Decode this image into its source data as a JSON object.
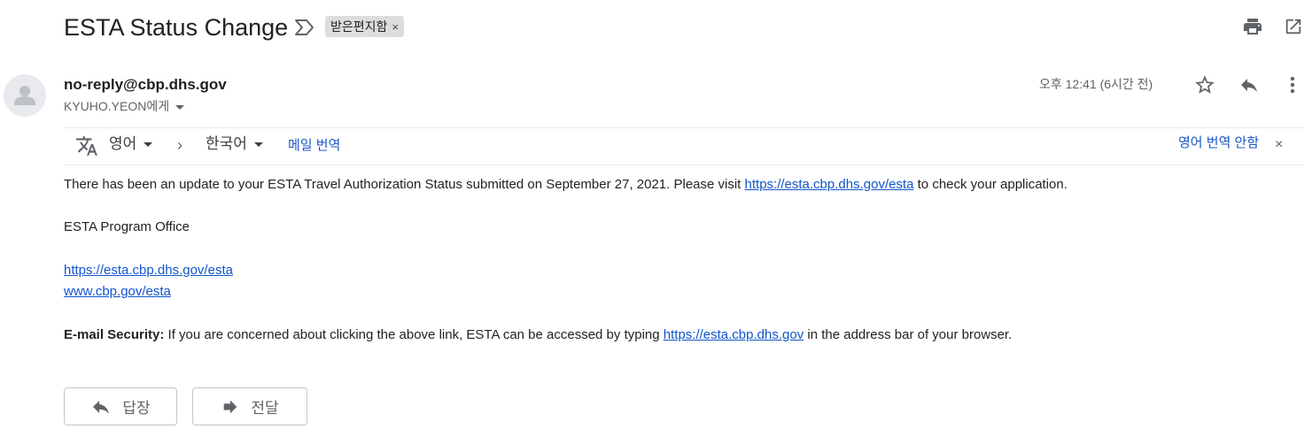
{
  "subject": "ESTA Status Change",
  "label_chip": {
    "text": "받은편지함",
    "remove_glyph": "×"
  },
  "sender": {
    "email": "no-reply@cbp.dhs.gov",
    "recipient": "KYUHO.YEON에게",
    "timestamp": "오후 12:41 (6시간 전)"
  },
  "translation_bar": {
    "from_language": "영어",
    "arrow": "›",
    "to_language": "한국어",
    "translate_link": "메일 번역",
    "no_translate_link": "영어 번역 안함",
    "close_glyph": "×"
  },
  "body": {
    "p1_before": "There has been an update to your ESTA Travel Authorization Status submitted on September 27, 2021. Please visit ",
    "p1_link": "https://esta.cbp.dhs.gov/esta",
    "p1_after": " to check your application.",
    "p2": "ESTA Program Office",
    "link1": "https://esta.cbp.dhs.gov/esta",
    "link2": "www.cbp.gov/esta",
    "security_label": "E-mail Security:",
    "security_before": " If you are concerned about clicking the above link, ESTA can be accessed by typing ",
    "security_link": "https://esta.cbp.dhs.gov",
    "security_after": " in the address bar of your browser."
  },
  "buttons": {
    "reply": "답장",
    "forward": "전달"
  },
  "colors": {
    "link": "#1155cc",
    "translate_link": "#1a57c8",
    "icon": "#5f6368",
    "chip_bg": "#dddddd"
  },
  "icons": {
    "important": "importance-marker-icon",
    "print": "print-icon",
    "popout": "open-in-new-window-icon",
    "avatar": "default-person-avatar-icon",
    "star": "star-outline-icon",
    "reply": "reply-arrow-icon",
    "more": "more-vertical-icon",
    "translate": "translate-icon",
    "forward": "forward-arrow-icon"
  }
}
